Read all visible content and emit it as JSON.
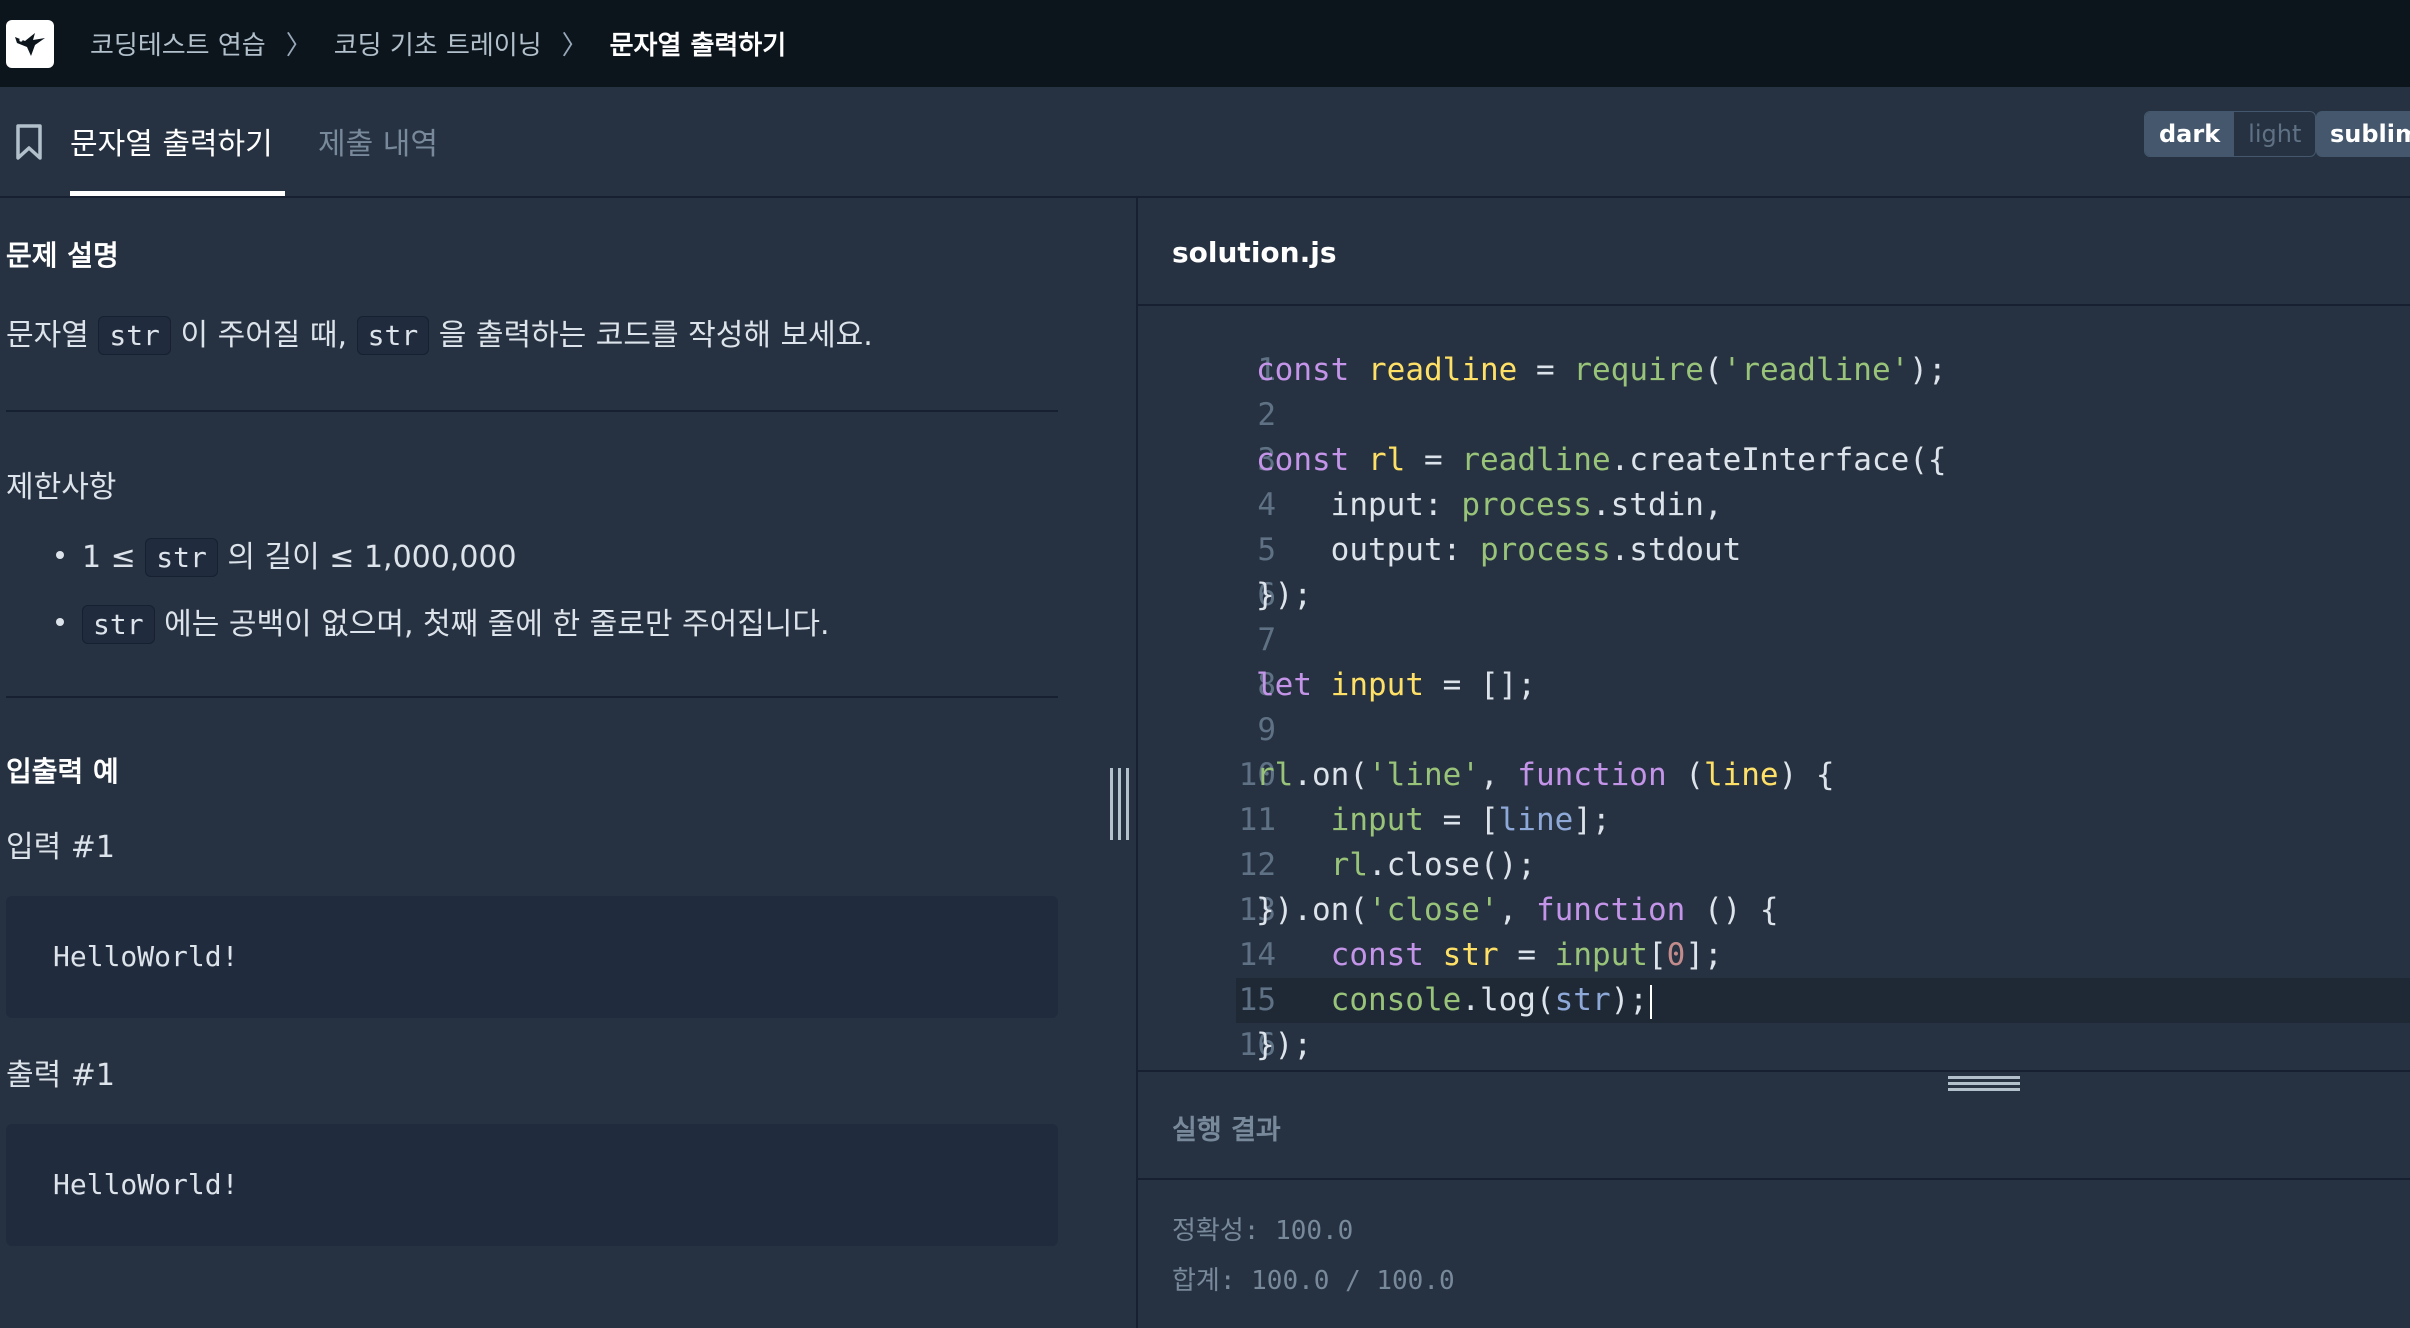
{
  "breadcrumb": {
    "items": [
      "코딩테스트 연습",
      "코딩 기초 트레이닝",
      "문자열 출력하기"
    ],
    "separator": "〉"
  },
  "tabs": {
    "active": "문자열 출력하기",
    "inactive": "제출 내역"
  },
  "theme": {
    "dark": "dark",
    "light": "light",
    "editor": "sublime"
  },
  "problem": {
    "heading": "문제 설명",
    "desc_part1": "문자열 ",
    "desc_code1": "str",
    "desc_part2": " 이 주어질 때, ",
    "desc_code2": "str",
    "desc_part3": " 을 출력하는 코드를 작성해 보세요.",
    "limits_heading": "제한사항",
    "limit1_pre": "1 ≤ ",
    "limit1_code": "str",
    "limit1_post": " 의 길이 ≤ 1,000,000",
    "limit2_code": "str",
    "limit2_post": " 에는 공백이 없으며, 첫째 줄에 한 줄로만 주어집니다.",
    "io_heading": "입출력 예",
    "input_label": "입력 #1",
    "input_value": "HelloWorld!",
    "output_label": "출력 #1",
    "output_value": "HelloWorld!"
  },
  "editor": {
    "filename": "solution.js",
    "line_numbers": [
      "1",
      "2",
      "3",
      "4",
      "5",
      "6",
      "7",
      "8",
      "9",
      "10",
      "11",
      "12",
      "13",
      "14",
      "15",
      "16"
    ],
    "current_line": 15
  },
  "result": {
    "title": "실행 결과",
    "accuracy": "정확성: 100.0",
    "total": "합계: 100.0 / 100.0"
  },
  "colors": {
    "nav_bg": "#0c151c",
    "panel_bg": "#263241",
    "code_block_bg": "#202b3d",
    "keyword": "#c394e8",
    "variable": "#ffe066",
    "string": "#98c379"
  }
}
